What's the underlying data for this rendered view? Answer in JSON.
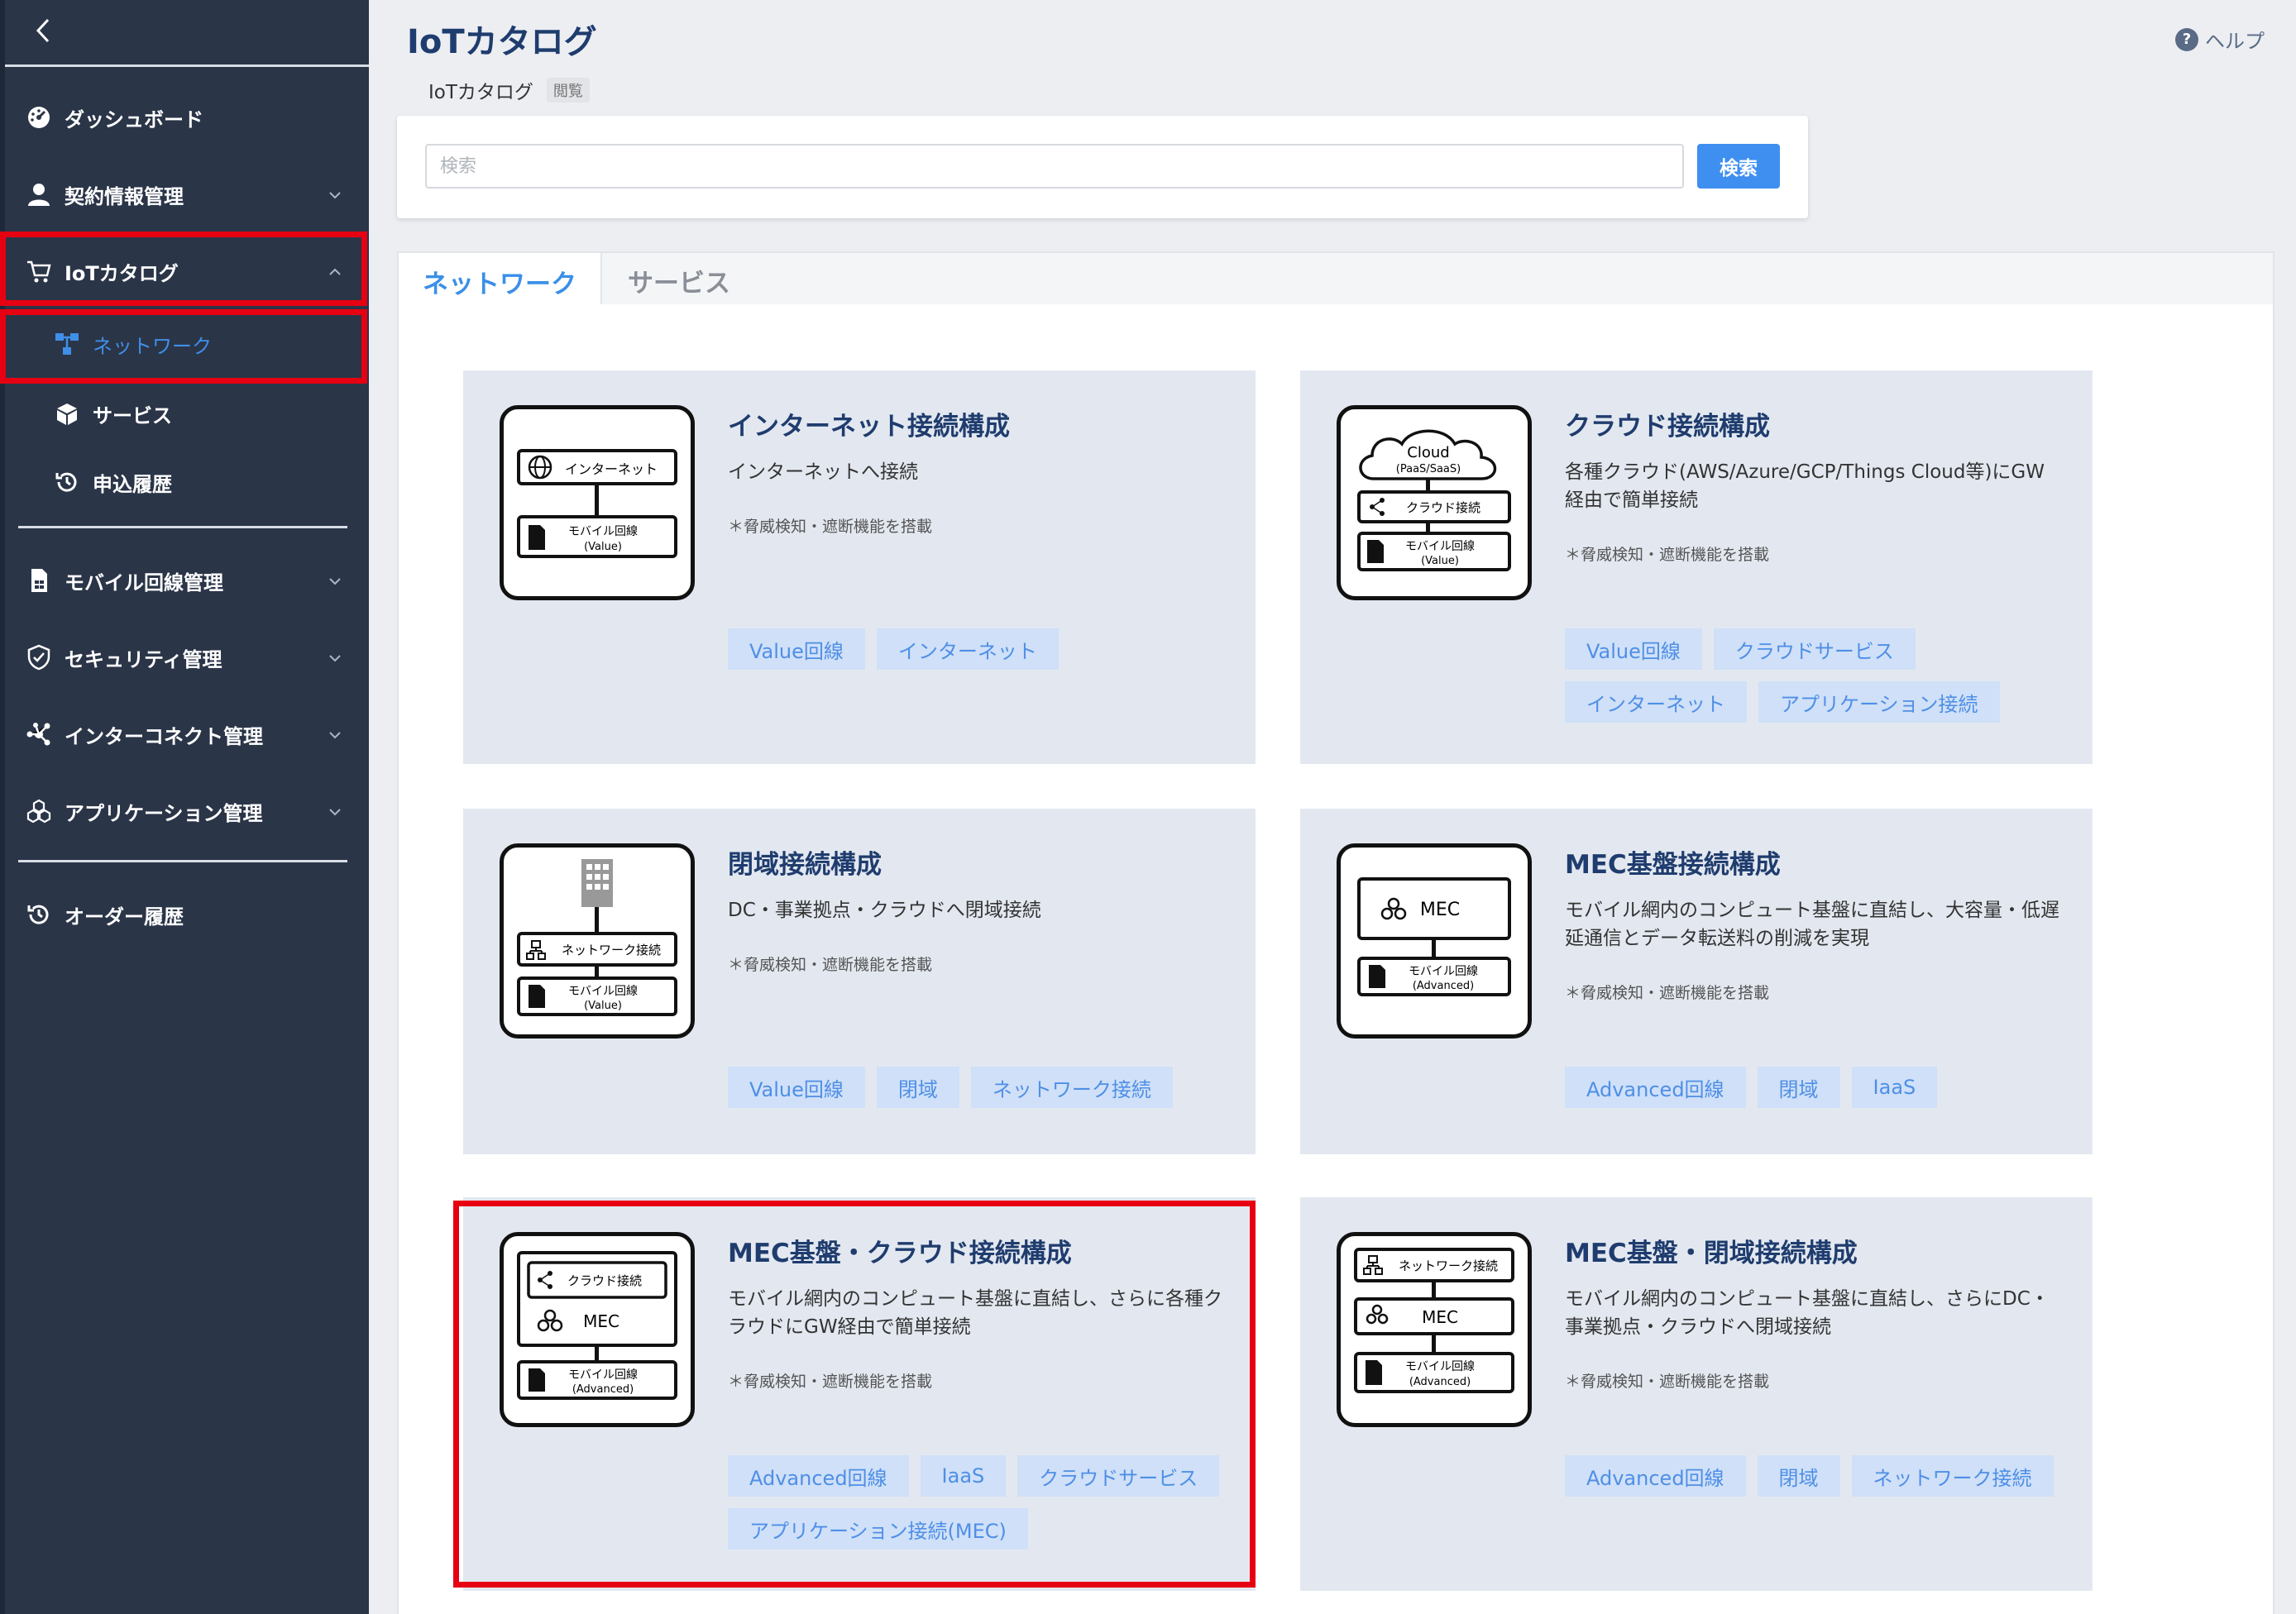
{
  "app": {
    "title": "IoTカタログ",
    "breadcrumb": {
      "current": "IoTカタログ",
      "badge": "閲覧"
    },
    "help_label": "ヘルプ"
  },
  "sidebar": {
    "items": [
      {
        "label": "ダッシュボード",
        "icon": "dashboard-icon"
      },
      {
        "label": "契約情報管理",
        "icon": "user-icon",
        "expandable": true
      },
      {
        "label": "IoTカタログ",
        "icon": "cart-icon",
        "expanded": true
      },
      {
        "label": "ネットワーク",
        "icon": "network-icon",
        "active": true
      },
      {
        "label": "サービス",
        "icon": "box-icon"
      },
      {
        "label": "申込履歴",
        "icon": "history-icon"
      },
      {
        "label": "モバイル回線管理",
        "icon": "sim-icon",
        "expandable": true
      },
      {
        "label": "セキュリティ管理",
        "icon": "shield-icon",
        "expandable": true
      },
      {
        "label": "インターコネクト管理",
        "icon": "interconnect-icon",
        "expandable": true
      },
      {
        "label": "アプリケーション管理",
        "icon": "apps-icon",
        "expandable": true
      },
      {
        "label": "オーダー履歴",
        "icon": "history-icon"
      }
    ]
  },
  "search": {
    "placeholder": "検索",
    "value": "",
    "button_label": "検索"
  },
  "tabs": [
    {
      "label": "ネットワーク",
      "active": true
    },
    {
      "label": "サービス",
      "active": false
    }
  ],
  "illus": {
    "internet": "インターネット",
    "mobile": "モバイル回線",
    "value": "(Value)",
    "advanced": "(Advanced)",
    "cloud": "Cloud",
    "paas": "(PaaS/SaaS)",
    "cloud_conn": "クラウド接続",
    "network_conn": "ネットワーク接続",
    "mec": "MEC"
  },
  "cards": [
    {
      "title": "インターネット接続構成",
      "description": "インターネットへ接続",
      "note": "＊脅威検知・遮断機能を搭載",
      "tags": [
        "Value回線",
        "インターネット"
      ]
    },
    {
      "title": "クラウド接続構成",
      "description": "各種クラウド(AWS/Azure/GCP/Things Cloud等)にGW経由で簡単接続",
      "note": "＊脅威検知・遮断機能を搭載",
      "tags": [
        "Value回線",
        "クラウドサービス",
        "インターネット",
        "アプリケーション接続"
      ]
    },
    {
      "title": "閉域接続構成",
      "description": "DC・事業拠点・クラウドへ閉域接続",
      "note": "＊脅威検知・遮断機能を搭載",
      "tags": [
        "Value回線",
        "閉域",
        "ネットワーク接続"
      ]
    },
    {
      "title": "MEC基盤接続構成",
      "description": "モバイル網内のコンピュート基盤に直結し、大容量・低遅延通信とデータ転送料の削減を実現",
      "note": "＊脅威検知・遮断機能を搭載",
      "tags": [
        "Advanced回線",
        "閉域",
        "IaaS"
      ]
    },
    {
      "title": "MEC基盤・クラウド接続構成",
      "description": "モバイル網内のコンピュート基盤に直結し、さらに各種クラウドにGW経由で簡単接続",
      "note": "＊脅威検知・遮断機能を搭載",
      "tags": [
        "Advanced回線",
        "IaaS",
        "クラウドサービス",
        "アプリケーション接続(MEC)"
      ]
    },
    {
      "title": "MEC基盤・閉域接続構成",
      "description": "モバイル網内のコンピュート基盤に直結し、さらにDC・事業拠点・クラウドへ閉域接続",
      "note": "＊脅威検知・遮断機能を搭載",
      "tags": [
        "Advanced回線",
        "閉域",
        "ネットワーク接続"
      ]
    }
  ],
  "colors": {
    "sidebar": "#2b3548",
    "accent": "#3e8ff0",
    "title": "#1f3c6e",
    "card": "#e3e8f0",
    "tag_bg": "#cfe0f8",
    "highlight": "#e60012"
  }
}
